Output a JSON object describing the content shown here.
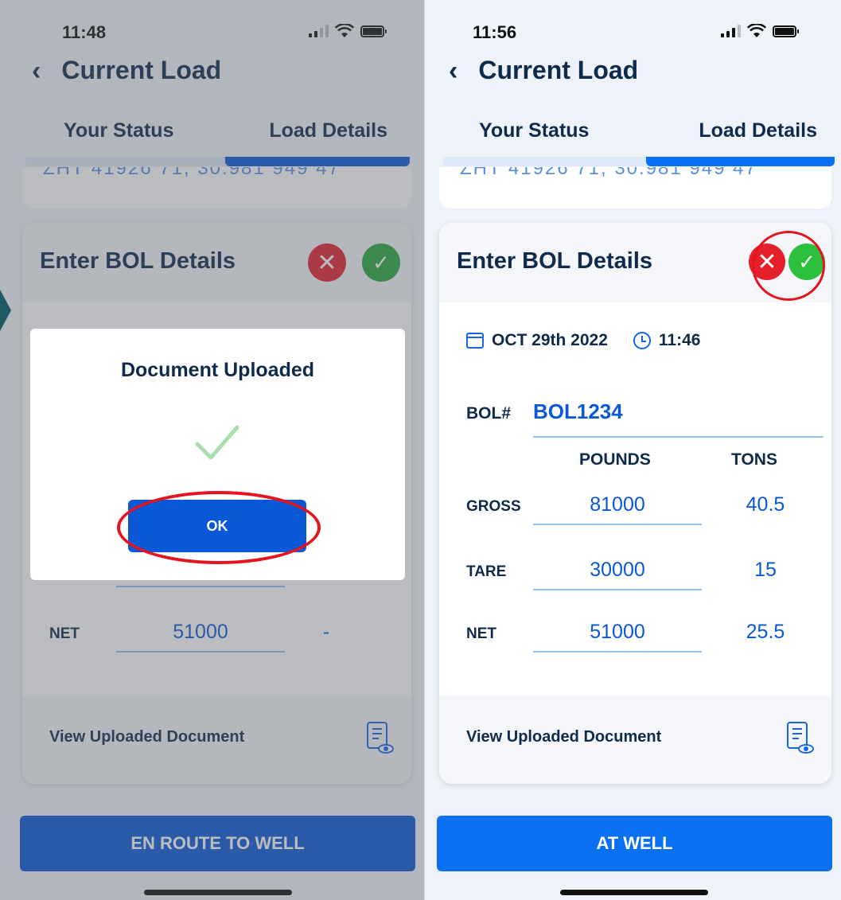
{
  "left": {
    "status_time": "11:48",
    "header": {
      "title": "Current Load"
    },
    "tabs": [
      {
        "label": "Your Status"
      },
      {
        "label": "Load Details"
      }
    ],
    "prev_card_text": "ZHT 41926 71, 30.981 949 47",
    "bol_card": {
      "title": "Enter BOL Details"
    },
    "net_row": {
      "label": "NET",
      "pounds": "51000",
      "tons": "-"
    },
    "view_document_label": "View Uploaded Document",
    "bottom_button": "EN ROUTE TO WELL",
    "modal": {
      "title": "Document Uploaded",
      "ok_label": "OK"
    }
  },
  "right": {
    "status_time": "11:56",
    "header": {
      "title": "Current Load"
    },
    "tabs": [
      {
        "label": "Your Status"
      },
      {
        "label": "Load Details"
      }
    ],
    "prev_card_text": "ZHT 41926 71, 30.981 949 47",
    "bol_card": {
      "title": "Enter BOL Details",
      "date": "OCT 29th 2022",
      "time": "11:46",
      "bol_label": "BOL#",
      "bol_value": "BOL1234",
      "columns": {
        "pounds": "POUNDS",
        "tons": "TONS"
      },
      "rows": [
        {
          "label": "GROSS",
          "pounds": "81000",
          "tons": "40.5"
        },
        {
          "label": "TARE",
          "pounds": "30000",
          "tons": "15"
        },
        {
          "label": "NET",
          "pounds": "51000",
          "tons": "25.5"
        }
      ]
    },
    "view_document_label": "View Uploaded Document",
    "bottom_button": "AT WELL"
  },
  "colors": {
    "primary_blue": "#0a58d6",
    "accent_blue": "#1565e6",
    "reject_red": "#e4202a",
    "accept_green": "#26a83a",
    "highlight_red": "#e5141f",
    "title_navy": "#0f2a4a"
  }
}
